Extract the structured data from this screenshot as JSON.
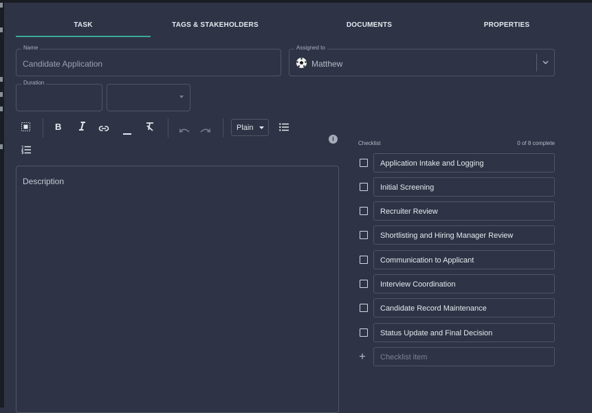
{
  "tabs": [
    {
      "label": "TASK",
      "active": true
    },
    {
      "label": "TAGS & STAKEHOLDERS",
      "active": false
    },
    {
      "label": "DOCUMENTS",
      "active": false
    },
    {
      "label": "PROPERTIES",
      "active": false
    }
  ],
  "name_field": {
    "label": "Name",
    "value": "Candidate Application"
  },
  "assigned_field": {
    "label": "Assigned to",
    "value": "Matthew"
  },
  "duration_field": {
    "label": "Duration",
    "value": ""
  },
  "toolbar": {
    "format_select": "Plain"
  },
  "description": {
    "placeholder": "Description"
  },
  "checklist": {
    "title": "Checklist",
    "count": "0 of 8 complete",
    "items": [
      "Application Intake and Logging",
      "Initial Screening",
      "Recruiter Review",
      "Shortlisting and Hiring Manager Review",
      "Communication to Applicant",
      "Interview Coordination",
      "Candidate Record Maintenance",
      "Status Update and Final Decision"
    ],
    "new_item_placeholder": "Checklist item"
  }
}
